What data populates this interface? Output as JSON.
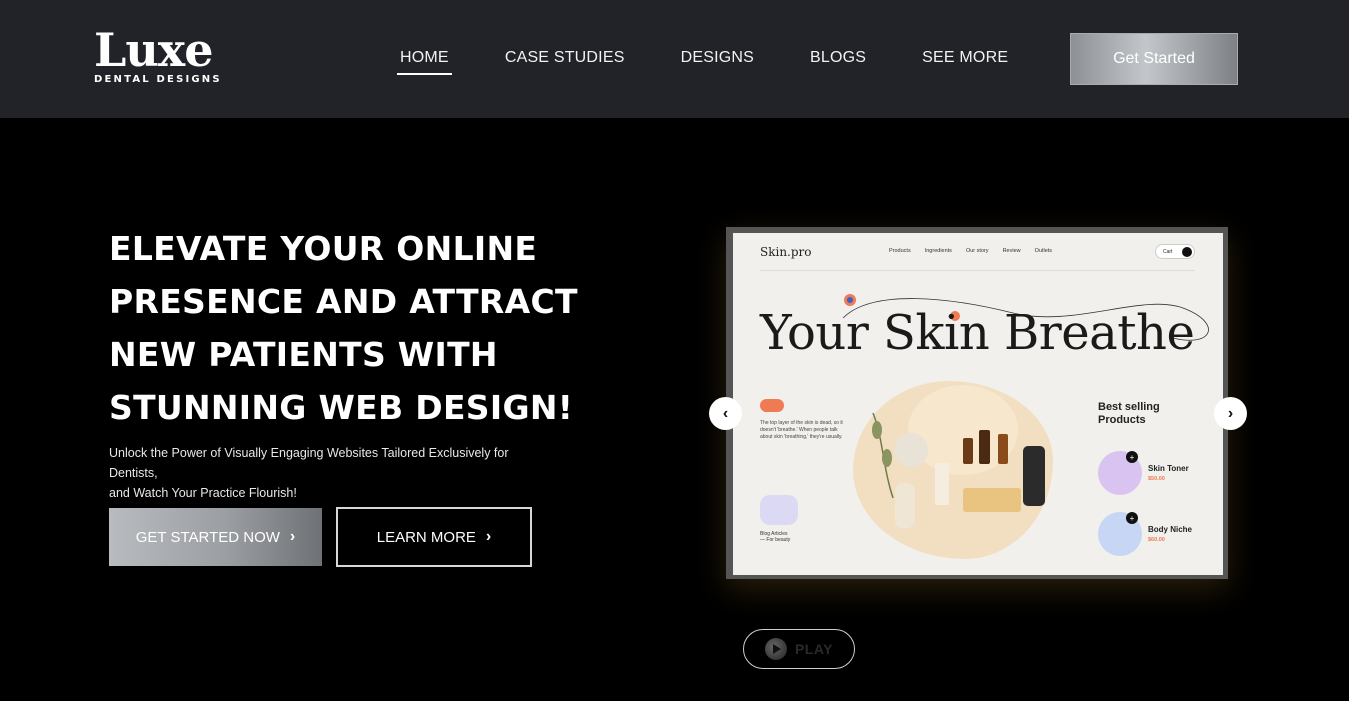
{
  "logo": {
    "main": "Luxe",
    "sub": "DENTAL DESIGNS"
  },
  "nav": {
    "items": [
      {
        "label": "HOME",
        "active": true
      },
      {
        "label": "CASE STUDIES"
      },
      {
        "label": "DESIGNS"
      },
      {
        "label": "BLOGS"
      },
      {
        "label": "SEE MORE"
      }
    ],
    "cta": "Get Started"
  },
  "hero": {
    "headline": "ELEVATE YOUR ONLINE PRESENCE AND ATTRACT NEW PATIENTS WITH STUNNING WEB DESIGN!",
    "subline_1": "Unlock the Power of Visually Engaging Websites Tailored Exclusively for Dentists,",
    "subline_2": "and Watch Your Practice Flourish!",
    "primary_button": "GET STARTED NOW",
    "secondary_button": "LEARN MORE"
  },
  "slider": {
    "prev_icon": "‹",
    "next_icon": "›",
    "mockup": {
      "brand": "Skin.pro",
      "nav": [
        "Products",
        "Ingredients",
        "Our story",
        "Review",
        "Outlets"
      ],
      "cart": "Cart",
      "title": "Your Skin Breathe",
      "description": "The top layer of the skin is dead, so it doesn't 'breathe.' When people talk about skin 'breathing,' they're usually.",
      "thumb_label_1": "Blog Articles",
      "thumb_label_2": "— For beauty",
      "best_selling": "Best selling Products",
      "products": [
        {
          "name": "Skin Toner",
          "price": "$50.00",
          "color": "#d9c3f0"
        },
        {
          "name": "Body Niche",
          "price": "$60.00",
          "color": "#c7d6f5"
        }
      ]
    }
  },
  "play": {
    "label": "PLAY"
  },
  "colors": {
    "nav_bg": "#212328",
    "accent": "#f07a52"
  }
}
